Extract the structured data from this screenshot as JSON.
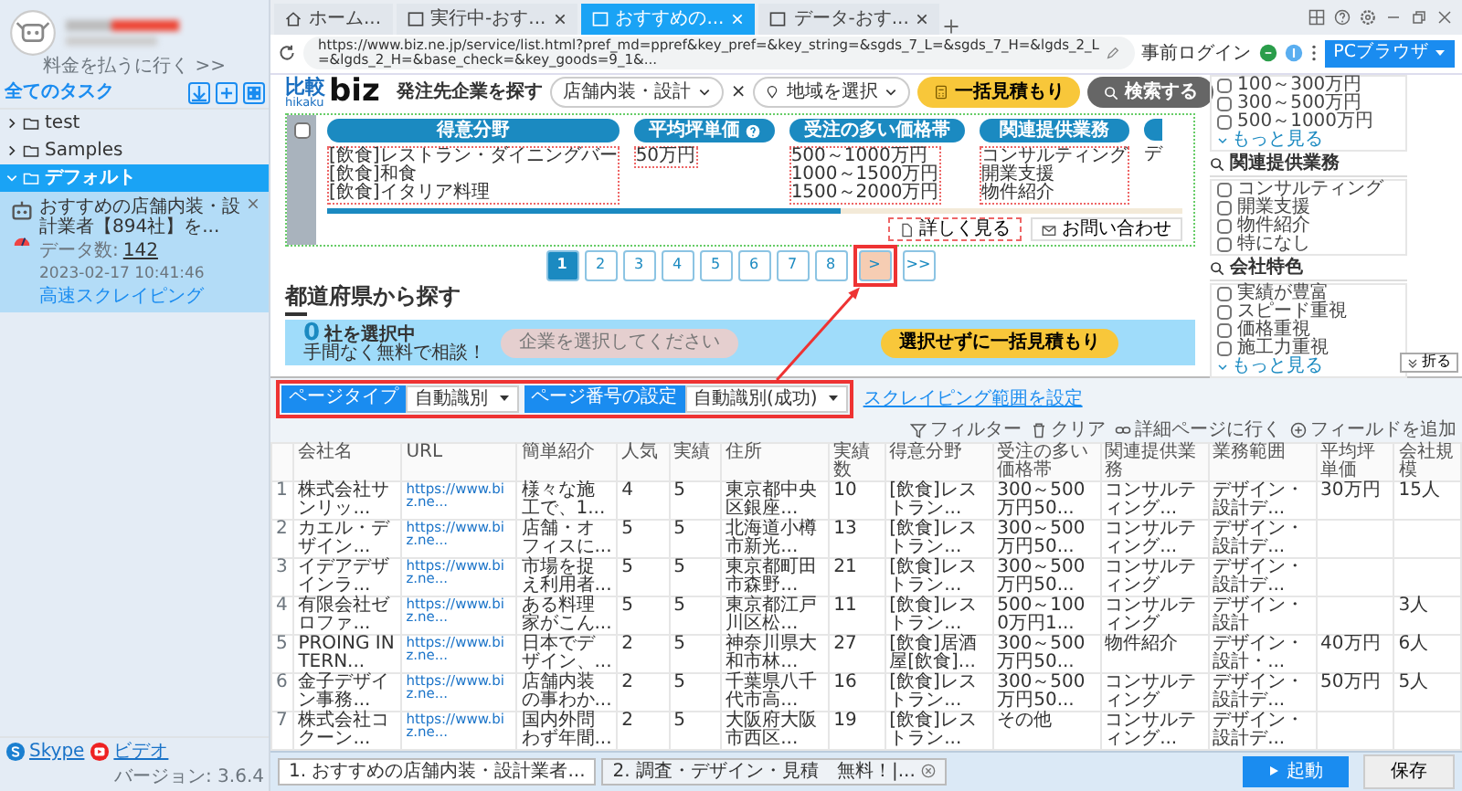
{
  "sidebar": {
    "pay_link": "料金を払うに行く >>",
    "all_tasks": "全てのタスク",
    "folders": [
      {
        "label": "test",
        "expanded": false,
        "selected": false
      },
      {
        "label": "Samples",
        "expanded": false,
        "selected": false
      },
      {
        "label": "デフォルト",
        "expanded": true,
        "selected": true,
        "tasks": [
          {
            "title": "おすすめの店舗内装・設計業者【894社】を...",
            "count_label": "データ数:",
            "count": "142",
            "time": "2023-02-17 10:41:46",
            "mode": "高速スクレイピング"
          }
        ]
      }
    ],
    "footer_links": [
      "Skype",
      "ビデオ"
    ],
    "version": "バージョン: 3.6.4"
  },
  "browser": {
    "tabs": [
      {
        "label": "ホーム...",
        "kind": "home",
        "selected": false,
        "closable": false
      },
      {
        "label": "実行中-おす...",
        "kind": "page",
        "selected": false,
        "closable": true
      },
      {
        "label": "おすすめの...",
        "kind": "page",
        "selected": true,
        "closable": true
      },
      {
        "label": "データ-おす...",
        "kind": "page",
        "selected": false,
        "closable": true
      }
    ],
    "url": "https://www.biz.ne.jp/service/list.html?pref_md=ppref&key_pref=&key_string=&sgds_7_L=&sgds_7_H=&lgds_2_L=&lgds_2_H=&base_check=&key_goods=9_1&...",
    "pre_login": "事前ログイン",
    "mode_button": "PCブラウザ"
  },
  "webpage": {
    "logo": {
      "kanji": "比較",
      "roman": "hikaku",
      "word": "biz"
    },
    "search_label": "発注先企業を探す",
    "category": "店舗内装・設計",
    "separator": "×",
    "region_placeholder": "地域を選択",
    "quote_button": "一括見積もり",
    "search_button": "検索する",
    "tag_columns": [
      {
        "heading": "得意分野",
        "help": false,
        "values": [
          "[飲食]レストラン・ダイニングバー",
          "[飲食]和食",
          "[飲食]イタリア料理"
        ]
      },
      {
        "heading": "平均坪単価",
        "help": true,
        "values": [
          "50万円"
        ]
      },
      {
        "heading": "受注の多い価格帯",
        "help": false,
        "values": [
          "500～1000万円",
          "1000～1500万円",
          "1500～2000万円"
        ]
      },
      {
        "heading": "関連提供業務",
        "help": false,
        "values": [
          "コンサルティング",
          "開業支援",
          "物件紹介"
        ]
      }
    ],
    "card_checkbox": {
      "checked": false
    },
    "cut_value": "デ",
    "card_scroll": {
      "level": 0.6
    },
    "card_buttons": [
      {
        "label": "詳しく見る",
        "kind": "details"
      },
      {
        "label": "お問い合わせ",
        "kind": "mail"
      }
    ],
    "pagination": [
      {
        "label": "1",
        "selected": true,
        "highlighted": false
      },
      {
        "label": "2",
        "selected": false,
        "highlighted": false
      },
      {
        "label": "3",
        "selected": false,
        "highlighted": false
      },
      {
        "label": "4",
        "selected": false,
        "highlighted": false
      },
      {
        "label": "5",
        "selected": false,
        "highlighted": false
      },
      {
        "label": "6",
        "selected": false,
        "highlighted": false
      },
      {
        "label": "7",
        "selected": false,
        "highlighted": false
      },
      {
        "label": "8",
        "selected": false,
        "highlighted": false
      },
      {
        "label": ">",
        "selected": false,
        "highlighted": true
      },
      {
        "label": ">>",
        "selected": false,
        "highlighted": false
      }
    ],
    "prefecture_heading": "都道府県から探す",
    "selection_bar": {
      "count": "0",
      "count_suffix": "社を選択中",
      "sub": "手間なく無料で相談！",
      "select_button": "企業を選択してください",
      "quote_button": "選択せずに一括見積もり"
    },
    "filters": [
      {
        "options": [
          {
            "label": "100～300万円",
            "checked": false
          },
          {
            "label": "300～500万円",
            "checked": false
          },
          {
            "label": "500～1000万円",
            "checked": false
          }
        ],
        "more": "もっと見る"
      },
      {
        "heading": "関連提供業務",
        "options": [
          {
            "label": "コンサルティング",
            "checked": false
          },
          {
            "label": "開業支援",
            "checked": false
          },
          {
            "label": "物件紹介",
            "checked": false
          },
          {
            "label": "特になし",
            "checked": false
          }
        ]
      },
      {
        "heading": "会社特色",
        "options": [
          {
            "label": "実績が豊富",
            "checked": false
          },
          {
            "label": "スピード重視",
            "checked": false
          },
          {
            "label": "価格重視",
            "checked": false
          },
          {
            "label": "施工力重視",
            "checked": false
          }
        ],
        "more": "もっと見る"
      }
    ],
    "fold_button": "折る"
  },
  "toolbar": {
    "page_type_label": "ページタイプ",
    "page_type_value": "自動識別",
    "page_number_label": "ページ番号の設定",
    "page_number_value": "自動識別(成功)",
    "range_link": "スクレイピング範囲を設定",
    "actions": [
      {
        "label": "フィルター",
        "kind": "filter"
      },
      {
        "label": "クリア",
        "kind": "trash"
      },
      {
        "label": "詳細ページに行く",
        "kind": "link"
      },
      {
        "label": "フィールドを追加",
        "kind": "add"
      }
    ]
  },
  "table": {
    "columns": [
      "会社名",
      "URL",
      "簡単紹介",
      "人気",
      "実績",
      "住所",
      "実績数",
      "得意分野",
      "受注の多い価格帯",
      "関連提供業務",
      "業務範囲",
      "平均坪単価",
      "会社規模"
    ],
    "rows": [
      {
        "index": "1",
        "cells": [
          "株式会社サンリッ...",
          "https://www.biz.ne...",
          "様々な施工で、1...",
          "4",
          "5",
          "東京都中央区銀座...",
          "10",
          "[飲食]レストラン...",
          "300～500万円50...",
          "コンサルティング...",
          "デザイン・設計デ...",
          "30万円",
          "15人"
        ]
      },
      {
        "index": "2",
        "cells": [
          "カエル・デザイン...",
          "https://www.biz.ne...",
          "店舗・オフィスに...",
          "5",
          "5",
          "北海道小樽市新光...",
          "13",
          "[飲食]レストラン...",
          "300～500万円50...",
          "コンサルティング...",
          "デザイン・設計デ...",
          null,
          null
        ]
      },
      {
        "index": "3",
        "cells": [
          "イデアデザインラ...",
          "https://www.biz.ne...",
          "市場を捉え利用者...",
          "5",
          "5",
          "東京都町田市森野...",
          "21",
          "[飲食]レストラン...",
          "300～500万円50...",
          "コンサルティング",
          "デザイン・設計デ...",
          null,
          null
        ]
      },
      {
        "index": "4",
        "cells": [
          "有限会社ゼロファ...",
          "https://www.biz.ne...",
          "ある料理家がこん...",
          "5",
          "5",
          "東京都江戸川区松...",
          "11",
          "[飲食]レストラン...",
          "500～1000万円1...",
          "コンサルティング",
          "デザイン・設計",
          null,
          "3人"
        ]
      },
      {
        "index": "5",
        "cells": [
          "PROING INTERN...",
          "https://www.biz.ne...",
          "日本でデザイン、...",
          "2",
          "5",
          "神奈川県大和市林...",
          "27",
          "[飲食]居酒屋[飲食]...",
          "300～500万円50...",
          "物件紹介",
          "デザイン・設計・...",
          "40万円",
          "6人"
        ]
      },
      {
        "index": "6",
        "cells": [
          "金子デザイン事務...",
          "https://www.biz.ne...",
          "店舗内装の事わか...",
          "2",
          "5",
          "千葉県八千代市高...",
          "16",
          "[飲食]レストラン...",
          "300～500万円50...",
          "コンサルティング",
          "デザイン・設計デ...",
          "50万円",
          "5人"
        ]
      },
      {
        "index": "7",
        "cells": [
          "株式会社コクーン...",
          "https://www.biz.ne...",
          "国内外問わず年間...",
          "2",
          "5",
          "大阪府大阪市西区...",
          "19",
          "[飲食]レストラン...",
          "その他",
          "コンサルティング...",
          "デザイン・設計デ...",
          null,
          null
        ]
      }
    ]
  },
  "task_tabs": [
    {
      "label": "1. おすすめの店舗内装・設計業者...",
      "selected": true,
      "closable": false
    },
    {
      "label": "2. 調査・デザイン・見積　無料！|...",
      "selected": false,
      "closable": true
    }
  ],
  "start_button": "起動",
  "save_button": "保存"
}
